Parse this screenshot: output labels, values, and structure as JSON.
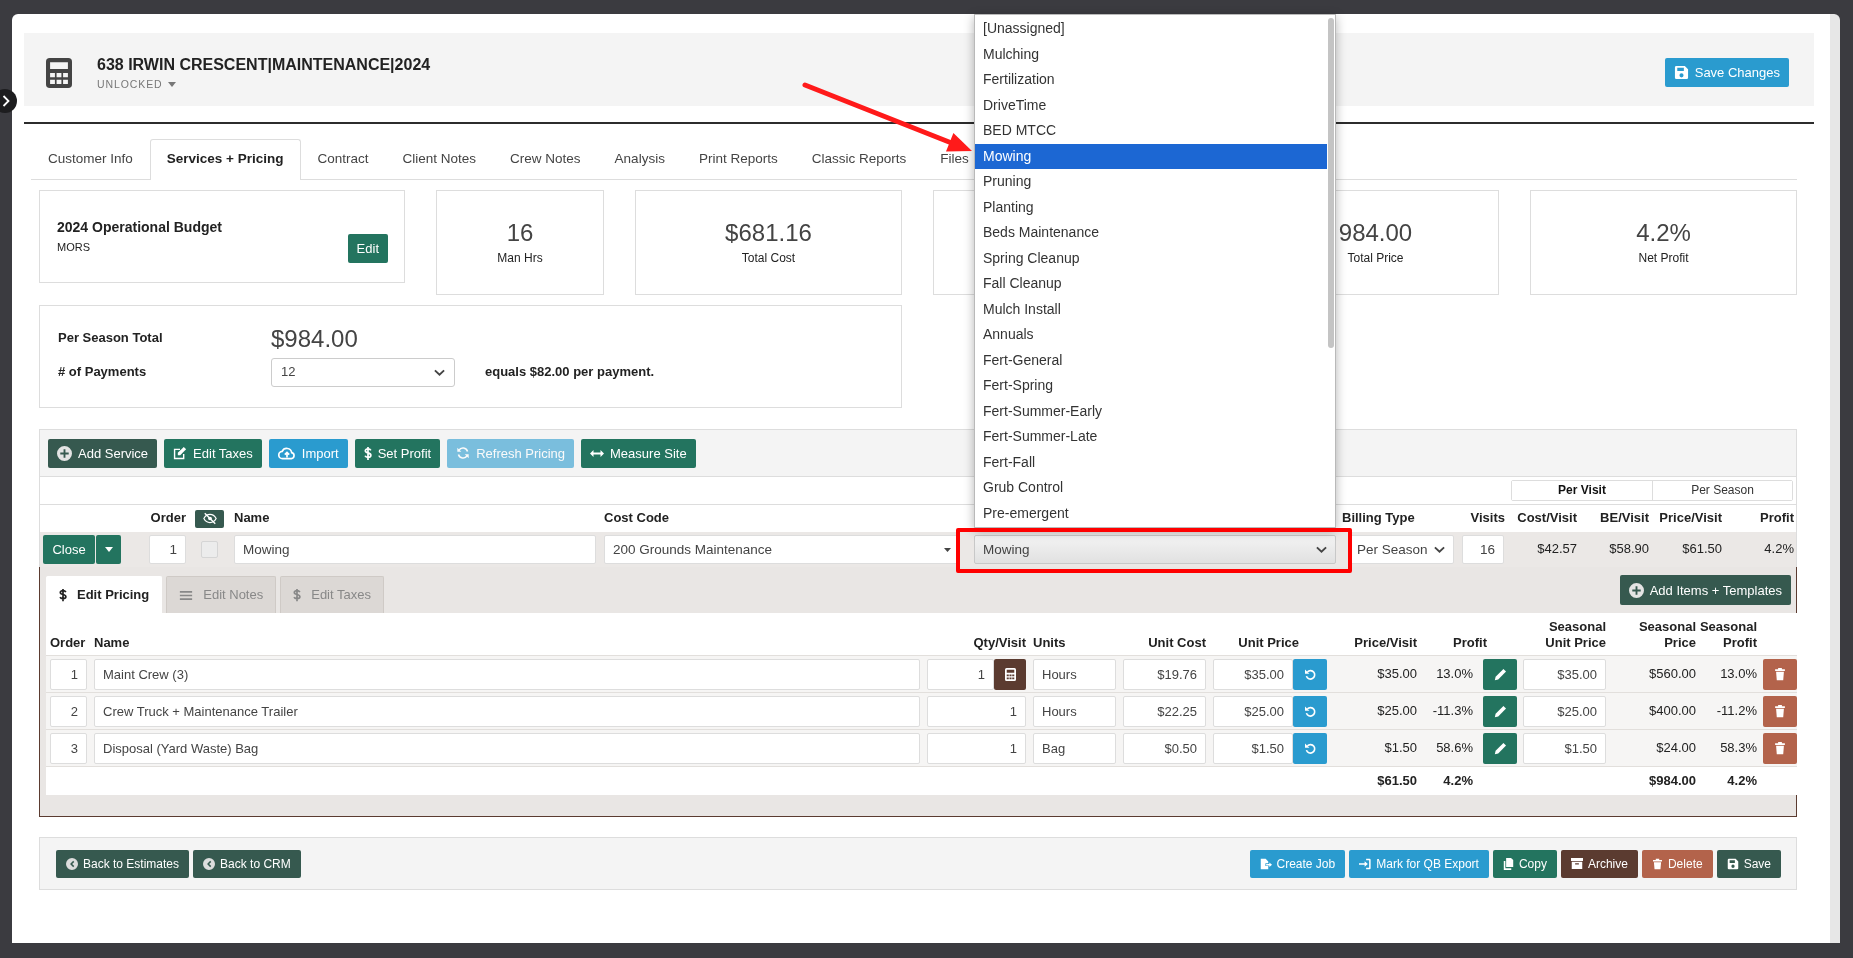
{
  "header": {
    "title": "638 IRWIN CRESCENT|MAINTENANCE|2024",
    "status": "UNLOCKED",
    "save_button": "Save Changes"
  },
  "tabs": [
    {
      "label": "Customer Info",
      "selected": false
    },
    {
      "label": "Services + Pricing",
      "selected": true
    },
    {
      "label": "Contract",
      "selected": false
    },
    {
      "label": "Client Notes",
      "selected": false
    },
    {
      "label": "Crew Notes",
      "selected": false
    },
    {
      "label": "Analysis",
      "selected": false
    },
    {
      "label": "Print Reports",
      "selected": false
    },
    {
      "label": "Classic Reports",
      "selected": false
    },
    {
      "label": "Files",
      "selected": false
    }
  ],
  "budget": {
    "title": "2024 Operational Budget",
    "subtitle": "MORS",
    "edit_button": "Edit"
  },
  "stats": [
    {
      "kind": "full",
      "value": "16",
      "label": "Man Hrs"
    },
    {
      "kind": "full",
      "value": "$681.16",
      "label": "Total Cost"
    },
    {
      "kind": "hidden"
    },
    {
      "kind": "partial",
      "value": "984.00",
      "label": "Total Price"
    },
    {
      "kind": "full",
      "value": "4.2%",
      "label": "Net Profit"
    }
  ],
  "season": {
    "total_label": "Per Season Total",
    "total_value": "$984.00",
    "payments_label": "# of Payments",
    "payments_value": "12",
    "payment_note": "equals $82.00 per payment."
  },
  "toolbar": [
    {
      "label": "Add Service",
      "kind": "dark",
      "disabled": false
    },
    {
      "label": "Edit Taxes",
      "kind": "green",
      "disabled": false
    },
    {
      "label": "Import",
      "kind": "blue",
      "disabled": false
    },
    {
      "label": "Set Profit",
      "kind": "green",
      "disabled": false
    },
    {
      "label": "Refresh Pricing",
      "kind": "blue",
      "disabled": true
    },
    {
      "label": "Measure Site",
      "kind": "green",
      "disabled": false
    }
  ],
  "rate_toggle": [
    {
      "label": "Per Visit",
      "selected": true
    },
    {
      "label": "Per Season",
      "selected": false
    }
  ],
  "service_table": {
    "columns": {
      "order": "Order",
      "name": "Name",
      "cost_code": "Cost Code",
      "billing_type": "Billing Type",
      "visits": "Visits",
      "cost_per_visit": "Cost/Visit",
      "be_per_visit": "BE/Visit",
      "price_per_visit": "Price/Visit",
      "profit": "Profit"
    },
    "row": {
      "close_button": "Close",
      "order": "1",
      "checked": false,
      "name": "Mowing",
      "cost_code": "200 Grounds Maintenance",
      "service": "Mowing",
      "billing_type": "Per Season",
      "visits": "16",
      "cost_per_visit": "$42.57",
      "be_per_visit": "$58.90",
      "price_per_visit": "$61.50",
      "profit": "4.2%"
    }
  },
  "service_menu": [
    {
      "label": "[Unassigned]",
      "selected": false
    },
    {
      "label": "Mulching",
      "selected": false
    },
    {
      "label": "Fertilization",
      "selected": false
    },
    {
      "label": "DriveTime",
      "selected": false
    },
    {
      "label": "BED MTCC",
      "selected": false
    },
    {
      "label": "Mowing",
      "selected": true
    },
    {
      "label": "Pruning",
      "selected": false
    },
    {
      "label": "Planting",
      "selected": false
    },
    {
      "label": "Beds Maintenance",
      "selected": false
    },
    {
      "label": "Spring Cleanup",
      "selected": false
    },
    {
      "label": "Fall Cleanup",
      "selected": false
    },
    {
      "label": "Mulch Install",
      "selected": false
    },
    {
      "label": "Annuals",
      "selected": false
    },
    {
      "label": "Fert-General",
      "selected": false
    },
    {
      "label": "Fert-Spring",
      "selected": false
    },
    {
      "label": "Fert-Summer-Early",
      "selected": false
    },
    {
      "label": "Fert-Summer-Late",
      "selected": false
    },
    {
      "label": "Fert-Fall",
      "selected": false
    },
    {
      "label": "Grub Control",
      "selected": false
    },
    {
      "label": "Pre-emergent",
      "selected": false
    }
  ],
  "edit_tabs": [
    {
      "label": "Edit Pricing",
      "selected": true
    },
    {
      "label": "Edit Notes",
      "selected": false
    },
    {
      "label": "Edit Taxes",
      "selected": false
    }
  ],
  "add_items_button": "Add Items + Templates",
  "pricing_table": {
    "columns": [
      "Order",
      "Name",
      "Qty/Visit",
      "Units",
      "Unit Cost",
      "Unit Price",
      "Price/Visit",
      "Profit",
      "Seasonal Unit Price",
      "Seasonal Price",
      "Seasonal Profit"
    ],
    "rows": [
      {
        "order": "1",
        "name": "Maint Crew (3)",
        "qty": "1",
        "calculator": true,
        "units": "Hours",
        "unit_cost": "$19.76",
        "unit_price": "$35.00",
        "price_per_visit": "$35.00",
        "profit": "13.0%",
        "seasonal_unit_price": "$35.00",
        "seasonal_price": "$560.00",
        "seasonal_profit": "13.0%"
      },
      {
        "order": "2",
        "name": "Crew Truck + Maintenance Trailer",
        "qty": "1",
        "calculator": false,
        "units": "Hours",
        "unit_cost": "$22.25",
        "unit_price": "$25.00",
        "price_per_visit": "$25.00",
        "profit": "-11.3%",
        "seasonal_unit_price": "$25.00",
        "seasonal_price": "$400.00",
        "seasonal_profit": "-11.2%"
      },
      {
        "order": "3",
        "name": "Disposal (Yard Waste) Bag",
        "qty": "1",
        "calculator": false,
        "units": "Bag",
        "unit_cost": "$0.50",
        "unit_price": "$1.50",
        "price_per_visit": "$1.50",
        "profit": "58.6%",
        "seasonal_unit_price": "$1.50",
        "seasonal_price": "$24.00",
        "seasonal_profit": "58.3%"
      }
    ],
    "totals": {
      "price_per_visit": "$61.50",
      "profit": "4.2%",
      "seasonal_price": "$984.00",
      "seasonal_profit": "4.2%"
    }
  },
  "footer": {
    "left": [
      {
        "label": "Back to Estimates",
        "kind": "dark"
      },
      {
        "label": "Back to CRM",
        "kind": "dark"
      }
    ],
    "right": [
      {
        "label": "Create Job",
        "kind": "blue"
      },
      {
        "label": "Mark for QB Export",
        "kind": "blue"
      },
      {
        "label": "Copy",
        "kind": "green"
      },
      {
        "label": "Archive",
        "kind": "brown"
      },
      {
        "label": "Delete",
        "kind": "red"
      },
      {
        "label": "Save",
        "kind": "dark"
      }
    ]
  }
}
